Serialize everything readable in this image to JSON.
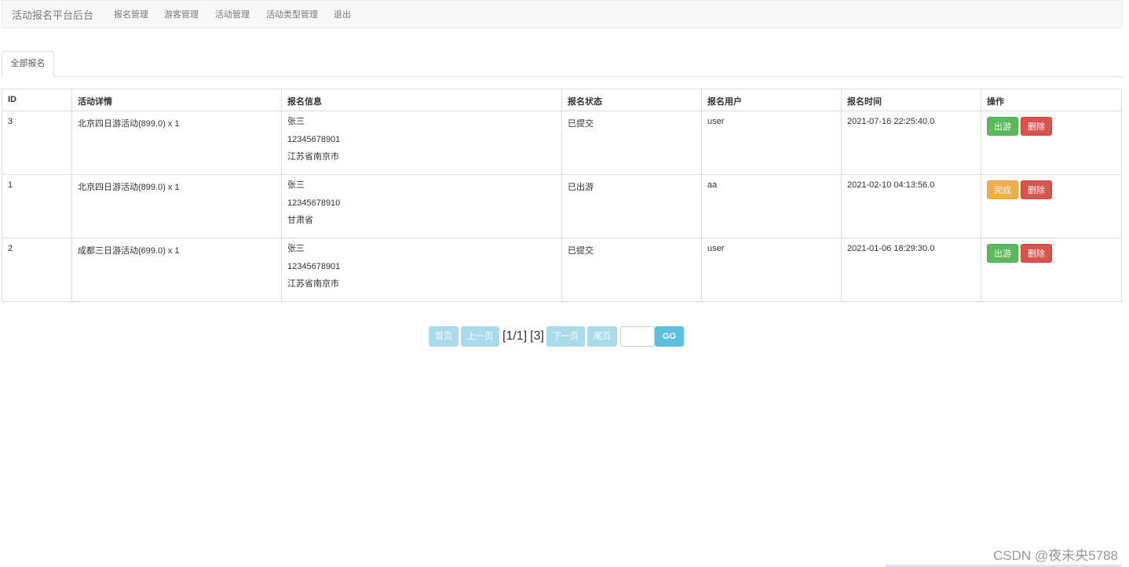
{
  "nav": {
    "brand": "活动报名平台后台",
    "links": [
      "报名管理",
      "游客管理",
      "活动管理",
      "活动类型管理",
      "退出"
    ]
  },
  "tabs": [
    "全部报名"
  ],
  "table": {
    "headers": [
      "ID",
      "活动详情",
      "报名信息",
      "报名状态",
      "报名用户",
      "报名时间",
      "操作"
    ],
    "rows": [
      {
        "id": "3",
        "detail": "北京四日游活动(899.0) x 1",
        "info": [
          "张三",
          "12345678901",
          "江苏省南京市"
        ],
        "status": "已提交",
        "user": "user",
        "time": "2021-07-16 22:25:40.0",
        "action_primary": "出游",
        "action_delete": "删除"
      },
      {
        "id": "1",
        "detail": "北京四日游活动(899.0) x 1",
        "info": [
          "张三",
          "12345678910",
          "甘肃省"
        ],
        "status": "已出游",
        "user": "aa",
        "time": "2021-02-10 04:13:56.0",
        "action_primary": "完成",
        "action_delete": "删除"
      },
      {
        "id": "2",
        "detail": "成都三日游活动(699.0) x 1",
        "info": [
          "张三",
          "12345678901",
          "江苏省南京市"
        ],
        "status": "已提交",
        "user": "user",
        "time": "2021-01-06 18:29:30.0",
        "action_primary": "出游",
        "action_delete": "删除"
      }
    ]
  },
  "pager": {
    "first": "首页",
    "prev": "上一页",
    "page_info": "[1/1]",
    "total": "[3]",
    "next": "下一页",
    "last": "尾页",
    "go": "GO"
  },
  "watermark": "CSDN @夜未央5788",
  "colors": {
    "submitted": "#d9252b",
    "traveled": "#2e8b2e",
    "btn_success": "#5cb85c",
    "btn_danger": "#d9534f",
    "btn_warning": "#f0ad4e"
  }
}
